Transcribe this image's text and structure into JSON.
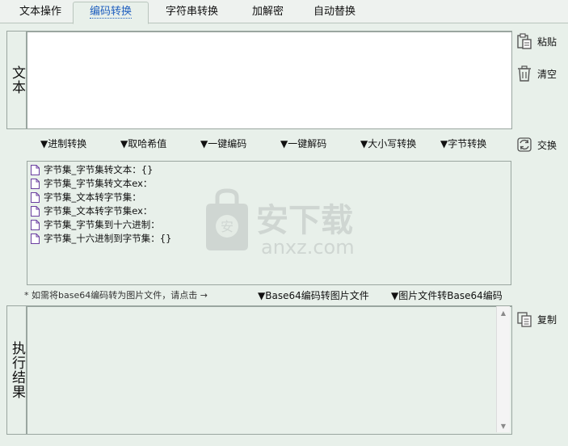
{
  "tabs": [
    {
      "label": "文本操作"
    },
    {
      "label": "编码转换"
    },
    {
      "label": "字符串转换"
    },
    {
      "label": "加解密"
    },
    {
      "label": "自动替换"
    }
  ],
  "input_section": {
    "label": "文本"
  },
  "side_buttons": {
    "paste": "粘贴",
    "clear": "清空",
    "swap": "交换",
    "copy": "复制"
  },
  "operations": [
    {
      "label": "▼进制转换"
    },
    {
      "label": "▼取哈希值"
    },
    {
      "label": "▼一键编码"
    },
    {
      "label": "▼一键解码"
    },
    {
      "label": "▼大小写转换"
    },
    {
      "label": "▼字节转换"
    }
  ],
  "functions": [
    {
      "label": "字节集_字节集转文本：{}"
    },
    {
      "label": "字节集_字节集转文本ex："
    },
    {
      "label": "字节集_文本转字节集："
    },
    {
      "label": "字节集_文本转字节集ex："
    },
    {
      "label": "字节集_字节集到十六进制："
    },
    {
      "label": "字节集_十六进制到字节集：{}"
    }
  ],
  "watermark": {
    "cn": "安下载",
    "en": "anxz.com"
  },
  "hint": "* 如需将base64编码转为图片文件，请点击 →",
  "base64_buttons": {
    "to_image": "▼Base64编码转图片文件",
    "to_base64": "▼图片文件转Base64编码"
  },
  "output_section": {
    "label": "执行结果"
  },
  "colors": {
    "accent": "#1f5fbf",
    "background": "#e8f0ea",
    "border": "#9aa6a0"
  }
}
